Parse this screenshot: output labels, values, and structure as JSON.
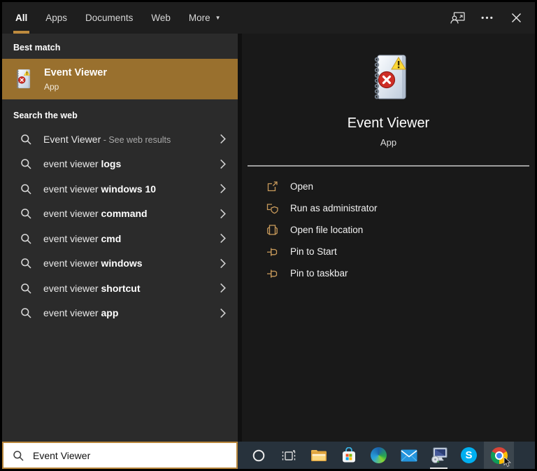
{
  "topbar": {
    "tabs": [
      {
        "label": "All",
        "active": true
      },
      {
        "label": "Apps",
        "active": false
      },
      {
        "label": "Documents",
        "active": false
      },
      {
        "label": "Web",
        "active": false
      },
      {
        "label": "More",
        "active": false,
        "has_dropdown": true
      }
    ],
    "icons": [
      "user-account-icon",
      "more-options-icon",
      "close-icon"
    ]
  },
  "best_match": {
    "header": "Best match",
    "item": {
      "title": "Event Viewer",
      "type": "App",
      "icon": "event-viewer-icon"
    }
  },
  "search_web": {
    "header": "Search the web",
    "items": [
      {
        "pre": "Event Viewer",
        "bold": "",
        "post": " - See web results"
      },
      {
        "pre": "event viewer ",
        "bold": "logs",
        "post": ""
      },
      {
        "pre": "event viewer ",
        "bold": "windows 10",
        "post": ""
      },
      {
        "pre": "event viewer ",
        "bold": "command",
        "post": ""
      },
      {
        "pre": "event viewer ",
        "bold": "cmd",
        "post": ""
      },
      {
        "pre": "event viewer ",
        "bold": "windows",
        "post": ""
      },
      {
        "pre": "event viewer ",
        "bold": "shortcut",
        "post": ""
      },
      {
        "pre": "event viewer ",
        "bold": "app",
        "post": ""
      }
    ]
  },
  "preview": {
    "title": "Event Viewer",
    "subtitle": "App",
    "icon": "event-viewer-icon",
    "actions": [
      {
        "label": "Open",
        "icon": "open-icon"
      },
      {
        "label": "Run as administrator",
        "icon": "run-as-admin-shield-icon"
      },
      {
        "label": "Open file location",
        "icon": "file-location-icon"
      },
      {
        "label": "Pin to Start",
        "icon": "pin-icon"
      },
      {
        "label": "Pin to taskbar",
        "icon": "pin-icon"
      }
    ]
  },
  "search_box": {
    "value": "Event Viewer",
    "icon": "search-icon"
  },
  "taskbar": {
    "items": [
      {
        "name": "cortana"
      },
      {
        "name": "task-view"
      },
      {
        "name": "file-explorer"
      },
      {
        "name": "microsoft-store"
      },
      {
        "name": "edge"
      },
      {
        "name": "mail"
      },
      {
        "name": "system-installer",
        "running": true
      },
      {
        "name": "skype"
      },
      {
        "name": "chrome",
        "active": true
      }
    ]
  },
  "colors": {
    "best_match_highlight": "#99702e",
    "tab_underline": "#bd8a3e",
    "action_icon_gold": "#c89a5b",
    "taskbar_bg": "#27323c",
    "left_panel_bg": "#2b2b2b",
    "right_panel_bg": "#191919"
  }
}
